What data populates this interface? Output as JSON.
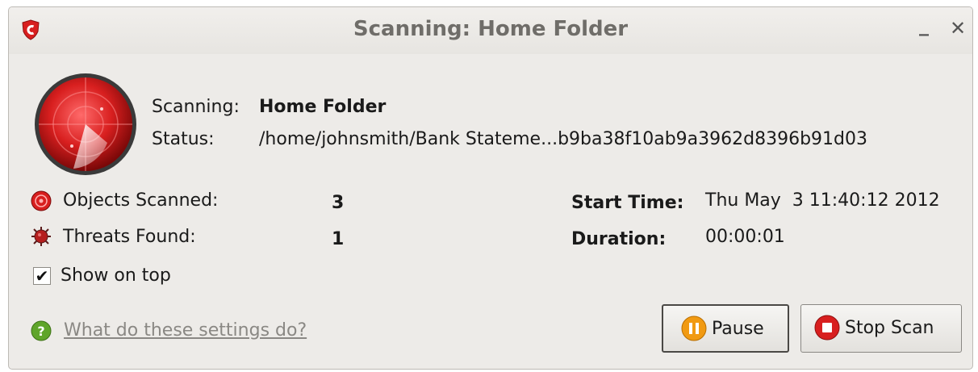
{
  "window": {
    "title": "Scanning: Home Folder",
    "minimize_glyph": "_",
    "close_glyph": "✕",
    "logo_icon": "comodo-shield-icon"
  },
  "scan": {
    "scanning_label": "Scanning:",
    "scanning_value": "Home Folder",
    "status_label": "Status:",
    "status_value": "/home/johnsmith/Bank Stateme...b9ba38f10ab9a3962d8396b91d03"
  },
  "stats": {
    "objects_label": "Objects Scanned:",
    "objects_value": "3",
    "threats_label": "Threats Found:",
    "threats_value": "1",
    "start_label": "Start Time:",
    "start_value": "Thu May  3 11:40:12 2012",
    "duration_label": "Duration:",
    "duration_value": "00:00:01"
  },
  "options": {
    "show_on_top_label": "Show on top",
    "show_on_top_checked": true
  },
  "help": {
    "link_text": "What do these settings do?"
  },
  "buttons": {
    "pause_label": "Pause",
    "stop_label": "Stop Scan"
  },
  "colors": {
    "accent_red": "#d81f1f",
    "pause_orange": "#f19a12",
    "help_green": "#5fa52a"
  }
}
